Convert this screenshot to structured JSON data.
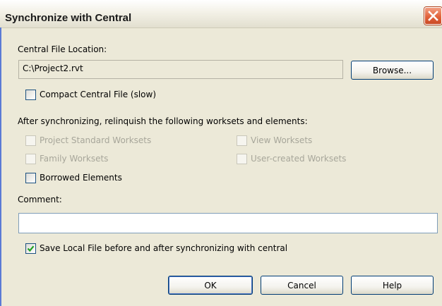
{
  "window": {
    "title": "Synchronize with Central"
  },
  "central": {
    "location_label": "Central File Location:",
    "path_value": "C:\\Project2.rvt",
    "browse_label": "Browse...",
    "compact_label": "Compact Central File (slow)",
    "compact_checked": false
  },
  "relinquish": {
    "heading": "After synchronizing, relinquish the following worksets and elements:",
    "project_standard_label": "Project Standard Worksets",
    "view_worksets_label": "View Worksets",
    "family_worksets_label": "Family Worksets",
    "user_created_label": "User-created Worksets",
    "borrowed_label": "Borrowed Elements"
  },
  "comment": {
    "label": "Comment:",
    "value": ""
  },
  "save_local": {
    "label": "Save Local File before and after synchronizing with central",
    "checked": true
  },
  "buttons": {
    "ok": "OK",
    "cancel": "Cancel",
    "help": "Help"
  },
  "icons": {
    "close": "close-icon",
    "check": "checkmark-icon"
  },
  "colors": {
    "dialog_bg": "#ece9d8",
    "close_button": "#e2623b",
    "checkmark": "#21a121",
    "disabled_text": "#a7a69a"
  }
}
